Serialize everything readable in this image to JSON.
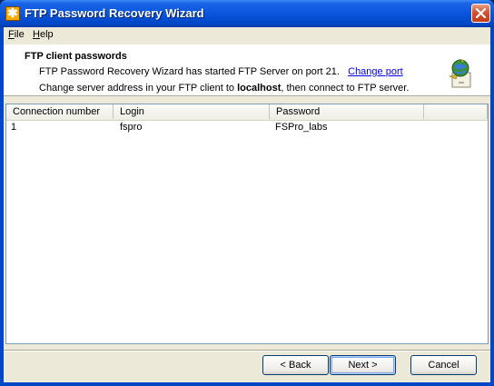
{
  "window": {
    "title": "FTP Password Recovery Wizard"
  },
  "menu": {
    "file_mnemonic": "F",
    "file_rest": "ile",
    "help_mnemonic": "H",
    "help_rest": "elp"
  },
  "header": {
    "title": "FTP client passwords",
    "line1_text": "FTP Password Recovery Wizard has started FTP Server on port 21.",
    "change_port_link": "Change port",
    "line2_prefix": "Change server address in your FTP client to ",
    "line2_host": "localhost",
    "line2_suffix": ", then connect to FTP server."
  },
  "table": {
    "columns": [
      "Connection number",
      "Login",
      "Password",
      ""
    ],
    "rows": [
      {
        "connection_number": "1",
        "login": "fspro",
        "password": "FSPro_labs"
      }
    ]
  },
  "buttons": {
    "back": "< Back",
    "next": "Next >",
    "cancel": "Cancel"
  }
}
